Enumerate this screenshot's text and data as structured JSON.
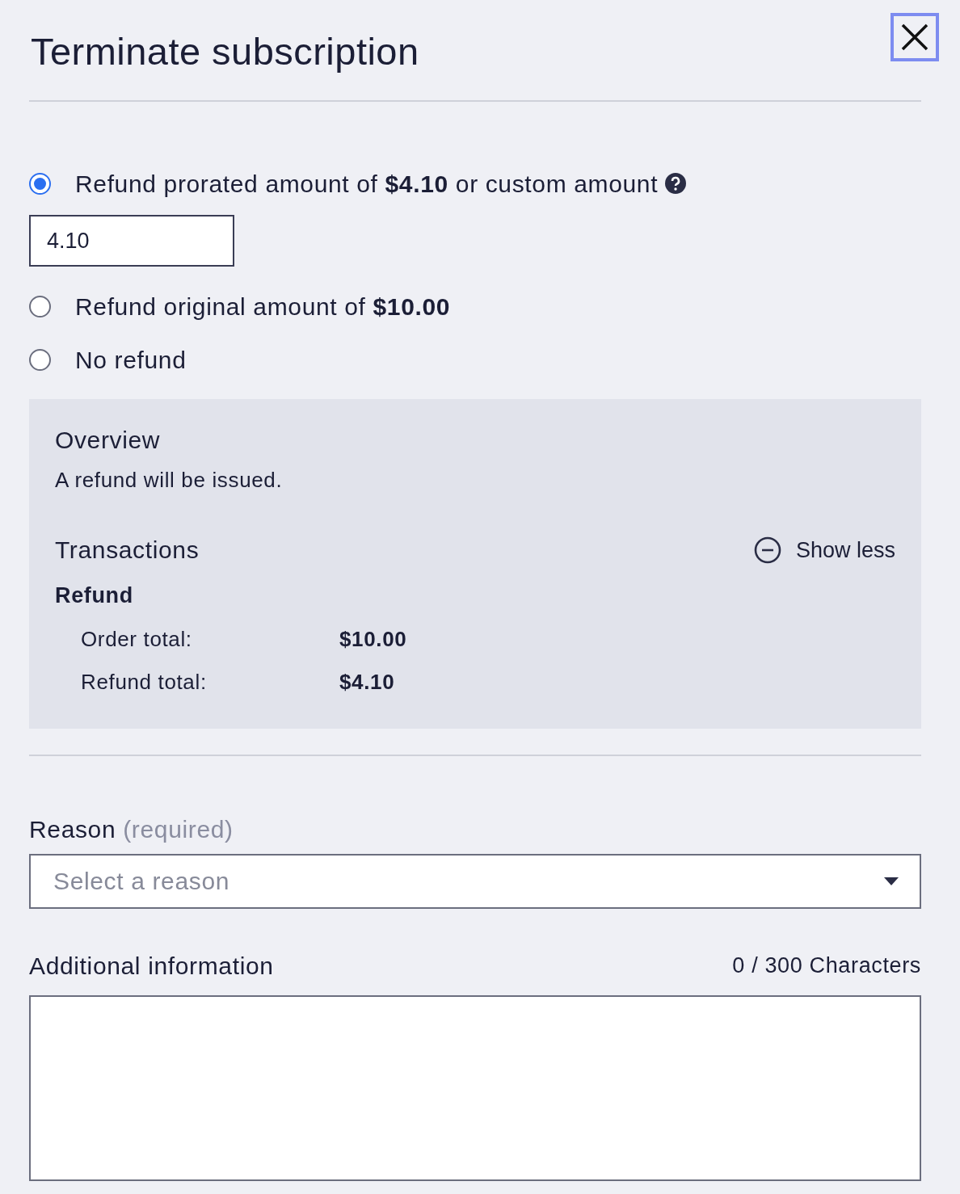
{
  "dialog": {
    "title": "Terminate subscription"
  },
  "refund_options": [
    {
      "label": "Refund prorated amount of **$4.10** or custom amount",
      "selected": true,
      "has_help": true,
      "amount_field": {
        "value": "4.10"
      }
    },
    {
      "label": "Refund original amount of **$10.00**",
      "selected": false,
      "has_help": false
    },
    {
      "label": "No refund",
      "selected": false,
      "has_help": false
    }
  ],
  "overview": {
    "title": "Overview",
    "message": "A refund will be issued.",
    "transactions_title": "Transactions",
    "toggle": "Show less",
    "expanded": true,
    "group": "Refund",
    "lines": [
      {
        "label": "Order total:",
        "value": "$10.00"
      },
      {
        "label": "Refund total:",
        "value": "$4.10"
      }
    ]
  },
  "reason": {
    "label": "Reason",
    "hint": "(required)",
    "placeholder": "Select a reason"
  },
  "additional": {
    "label": "Additional information",
    "counter": "0 / 300 Characters"
  }
}
